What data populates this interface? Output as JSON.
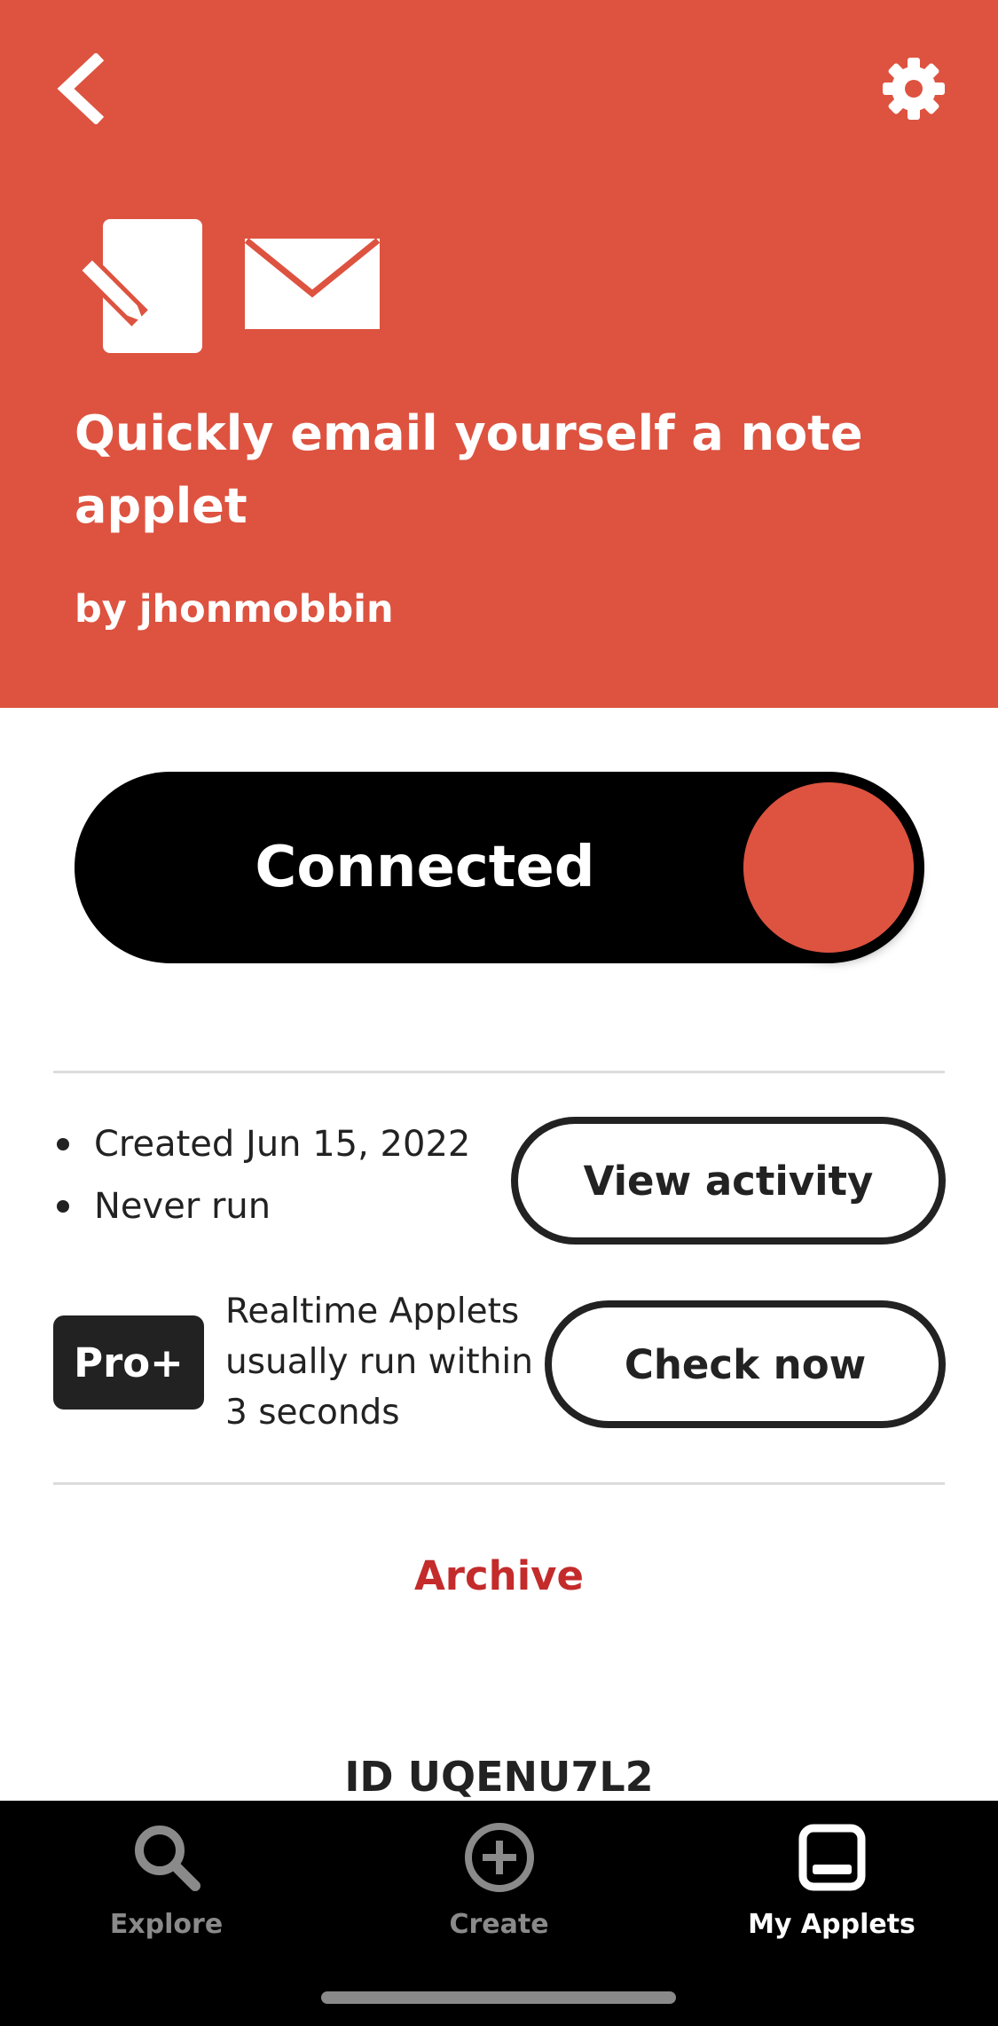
{
  "header": {
    "title": "Quickly email yourself a note applet",
    "author_prefix": "by",
    "author": "jhonmobbin",
    "services": [
      "note-widget-icon",
      "email-icon"
    ],
    "background_color": "#dd5340"
  },
  "toggle": {
    "label": "Connected",
    "state": "on",
    "knob_color": "#dd5340"
  },
  "meta": {
    "items": [
      "Created Jun 15, 2022",
      "Never run"
    ]
  },
  "actions": {
    "view_activity": "View activity",
    "check_now": "Check now",
    "archive": "Archive",
    "archive_color": "#c42b2b"
  },
  "pro": {
    "badge": "Pro+",
    "description": "Realtime Applets usually run within 3 seconds"
  },
  "applet_id": "ID UQENU7L2",
  "tabs": [
    {
      "label": "Explore",
      "icon": "search-icon",
      "active": false
    },
    {
      "label": "Create",
      "icon": "plus-circle-icon",
      "active": false
    },
    {
      "label": "My Applets",
      "icon": "applets-icon",
      "active": true
    }
  ],
  "colors": {
    "tab_active": "#ffffff",
    "tab_inactive": "#8a8a8a"
  }
}
